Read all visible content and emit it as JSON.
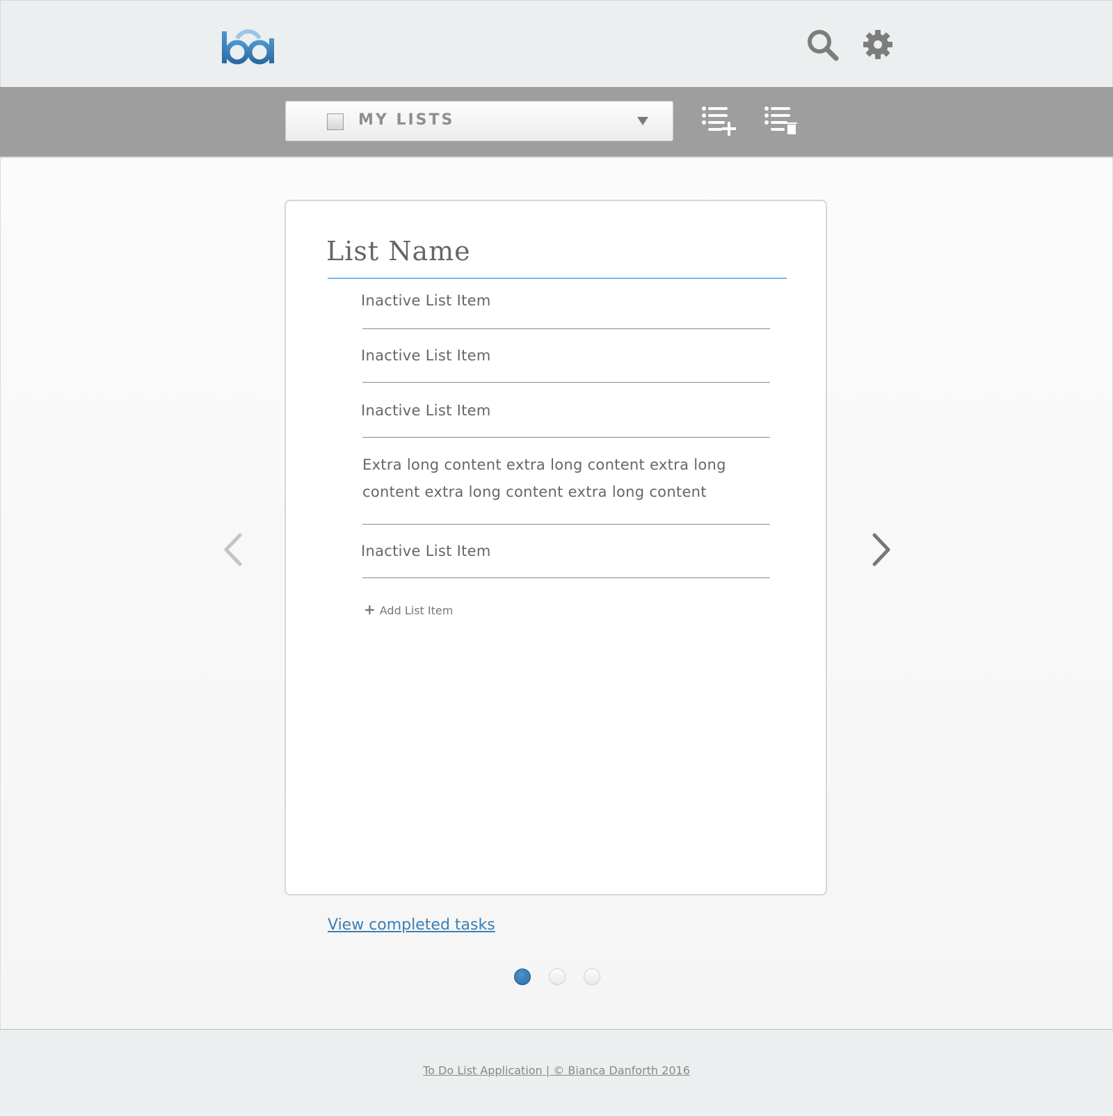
{
  "header": {
    "logo_text": "bd",
    "search_icon": "search-icon",
    "settings_icon": "gear-icon"
  },
  "toolbar": {
    "list_select_label": "MY LISTS",
    "add_list_icon": "list-add-icon",
    "delete_list_icon": "list-delete-icon"
  },
  "card": {
    "title": "List Name",
    "items": [
      "Inactive List Item",
      "Inactive List Item",
      "Inactive List Item",
      "Extra long content extra long content extra long content extra long content extra long content",
      "Inactive List Item"
    ],
    "add_item_label": "Add List Item"
  },
  "completed_link": "View completed tasks",
  "pagination": {
    "current": 1,
    "total": 3
  },
  "footer": {
    "text": "To Do List Application | © Bianca Danforth 2016"
  },
  "colors": {
    "accent": "#2f75ad",
    "header_bg": "#ecefef",
    "toolbar_bg": "#9e9e9e",
    "link": "#3a7fb5"
  }
}
